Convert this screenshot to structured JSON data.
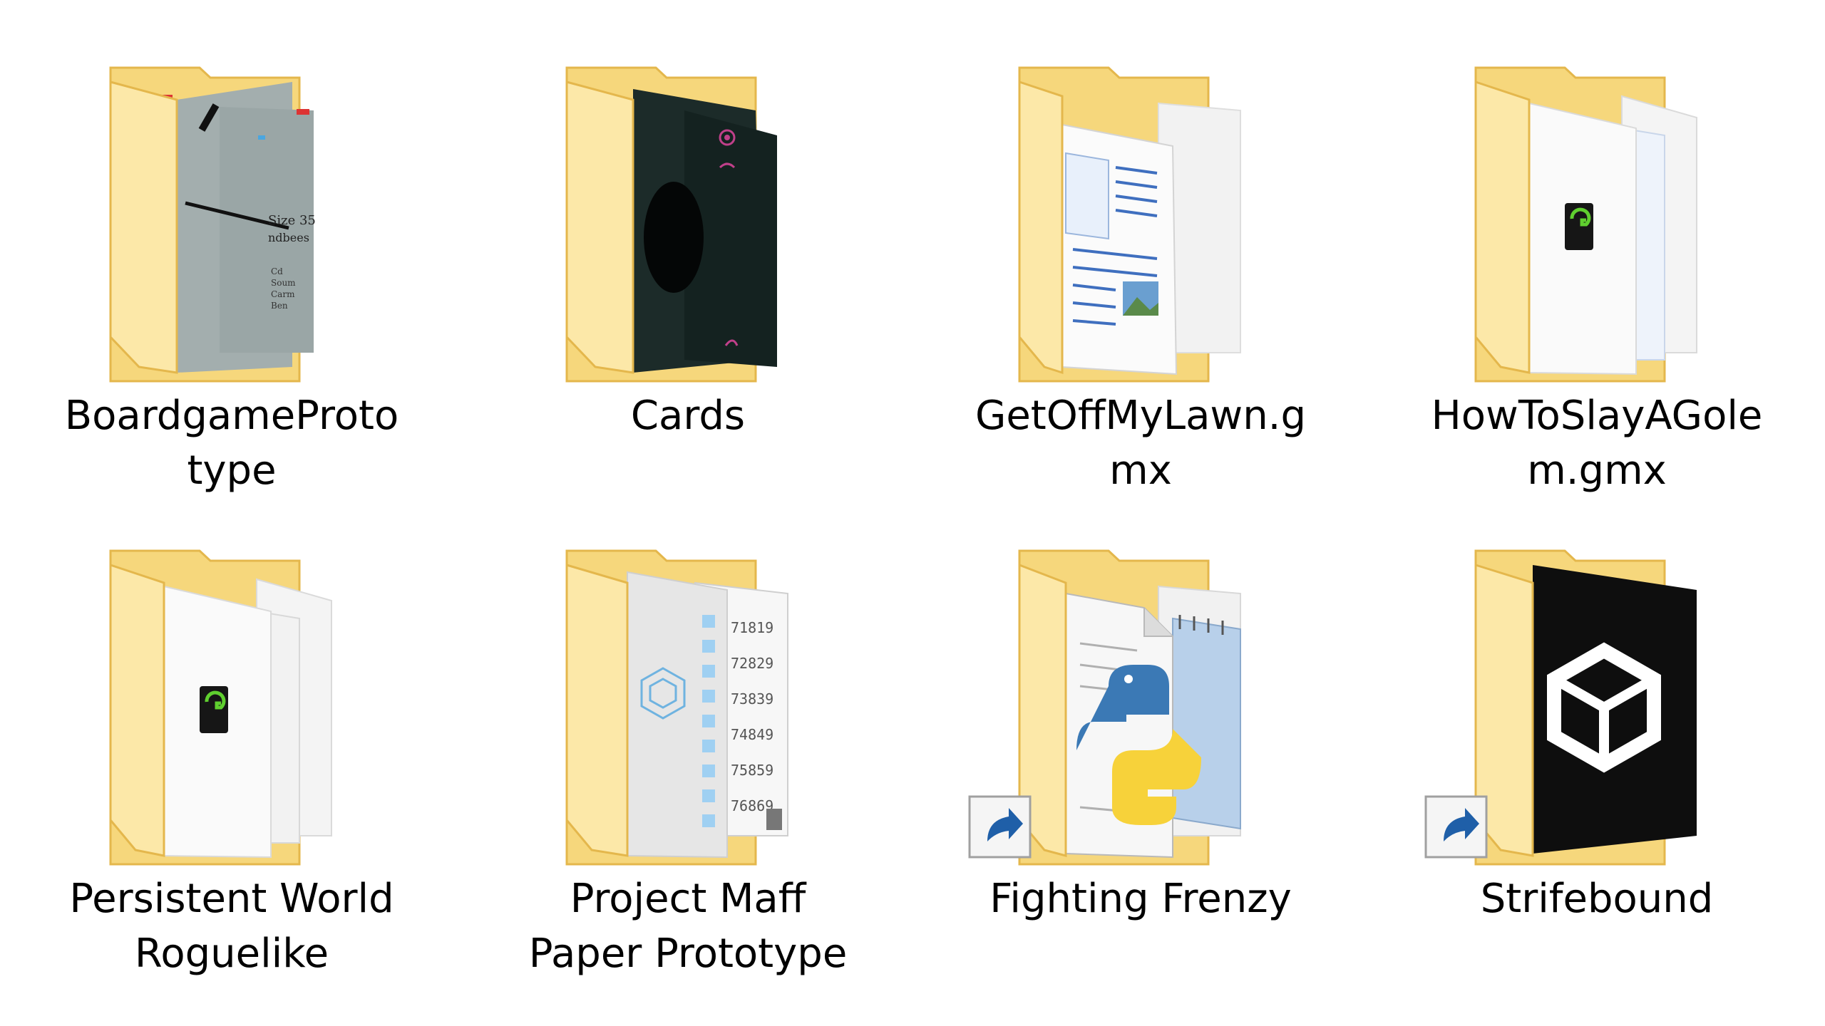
{
  "folders": [
    {
      "label": "BoardgameProto\ntype",
      "preview": "boardgame-sheet",
      "shortcut": false
    },
    {
      "label": "Cards",
      "preview": "dark-cards",
      "shortcut": false
    },
    {
      "label": "GetOffMyLawn.g\nmx",
      "preview": "document-page",
      "shortcut": false
    },
    {
      "label": "HowToSlayAGole\nm.gmx",
      "preview": "gamemaker-file",
      "shortcut": false
    },
    {
      "label": "Persistent World\nRoguelike",
      "preview": "gamemaker-file",
      "shortcut": false
    },
    {
      "label": "Project Maff\nPaper Prototype",
      "preview": "number-grid",
      "shortcut": false
    },
    {
      "label": "Fighting Frenzy",
      "preview": "python-notepad",
      "shortcut": true
    },
    {
      "label": "Strifebound",
      "preview": "unity-logo",
      "shortcut": true
    }
  ],
  "colors": {
    "folder_back": "#f6d77c",
    "folder_front": "#fce8a8",
    "folder_edge": "#e4b74c",
    "shortcut_arrow": "#1f5fa8"
  },
  "icons": {
    "folder": "folder-icon",
    "shortcut_overlay": "shortcut-arrow-icon"
  }
}
